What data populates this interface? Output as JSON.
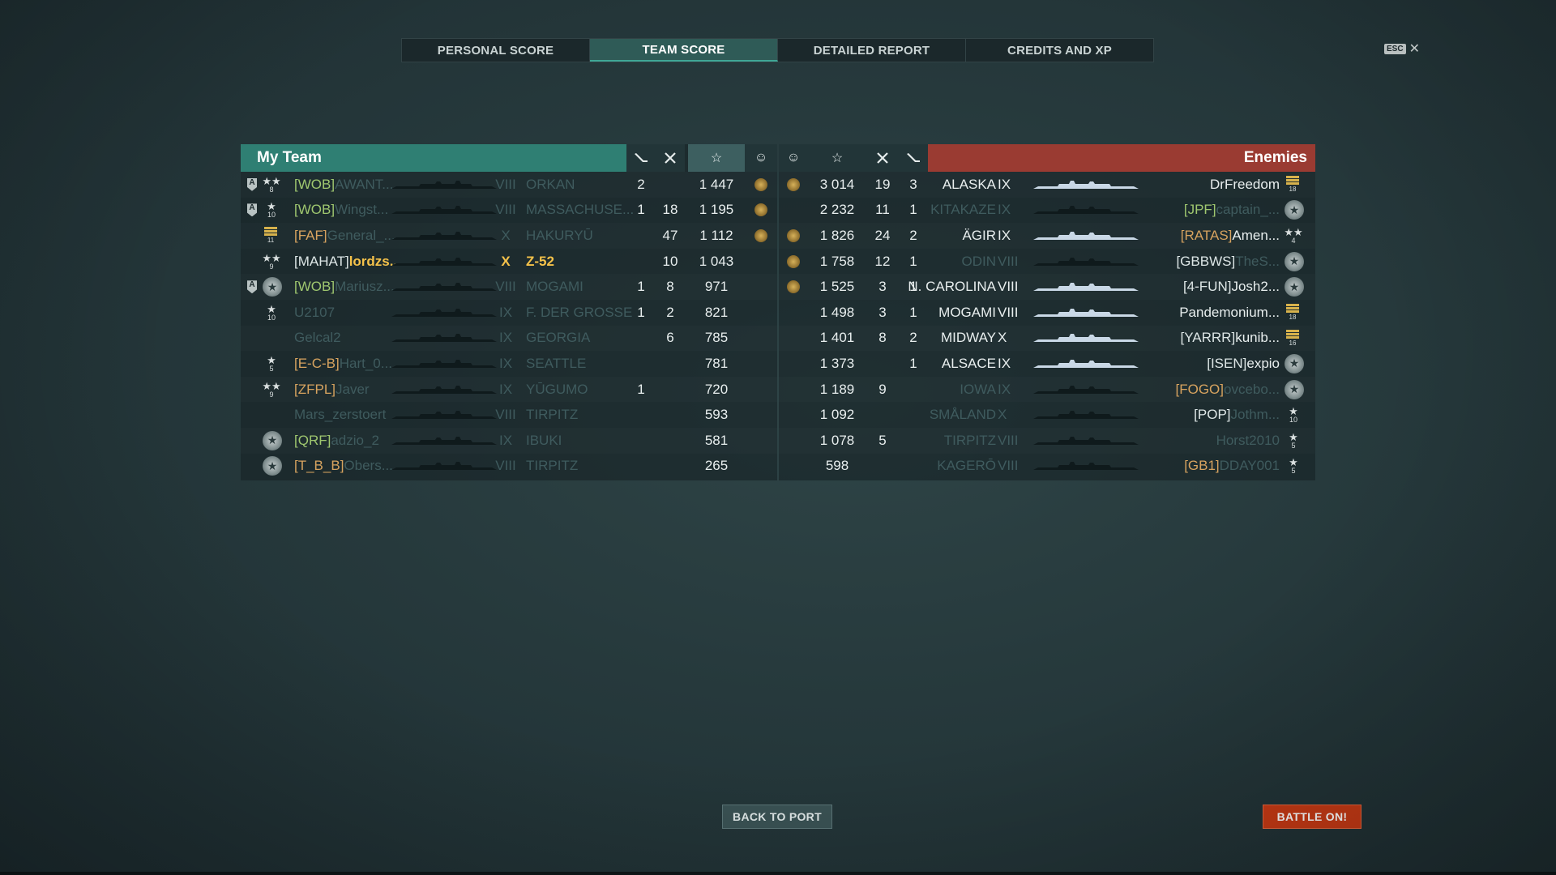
{
  "tabs": [
    "PERSONAL SCORE",
    "TEAM SCORE",
    "DETAILED REPORT",
    "CREDITS AND XP"
  ],
  "active_tab": 1,
  "esc_label": "ESC",
  "close_glyph": "✕",
  "my_team": {
    "title": "My Team",
    "rows": [
      {
        "badge": "A",
        "rank": "8",
        "rank_type": "stars2",
        "clan": "[WOB]",
        "clan_color": "green",
        "name": "AWANT...",
        "tier": "VIII",
        "ship": "ORKAN",
        "dimmed": true,
        "a": "2",
        "b": "",
        "score": "1 447",
        "medal": true
      },
      {
        "badge": "A",
        "rank": "10",
        "rank_type": "star",
        "clan": "[WOB]",
        "clan_color": "green",
        "name": "Wingst...",
        "tier": "VIII",
        "ship": "MASSACHUSE...",
        "dimmed": true,
        "a": "1",
        "b": "18",
        "score": "1 195",
        "medal": true
      },
      {
        "badge": "",
        "rank": "11",
        "rank_type": "stripes",
        "clan": "[FAF]",
        "clan_color": "orange",
        "name": "General_...",
        "tier": "X",
        "ship": "HAKURYŪ",
        "dimmed": true,
        "a": "",
        "b": "47",
        "score": "1 112",
        "medal": true
      },
      {
        "badge": "",
        "rank": "9",
        "rank_type": "stars2",
        "clan": "[MAHAT]",
        "clan_color": "white",
        "name": "lordzs...",
        "tier": "X",
        "ship": "Z-52",
        "dimmed": false,
        "me": true,
        "a": "",
        "b": "10",
        "score": "1 043",
        "medal": false
      },
      {
        "badge": "A",
        "rank": "",
        "rank_type": "emblem",
        "clan": "[WOB]",
        "clan_color": "green",
        "name": "Mariusz...",
        "tier": "VIII",
        "ship": "MOGAMI",
        "dimmed": true,
        "a": "1",
        "b": "8",
        "score": "971",
        "medal": false
      },
      {
        "badge": "",
        "rank": "10",
        "rank_type": "star",
        "clan": "",
        "clan_color": "green",
        "name": "U2107",
        "tier": "IX",
        "ship": "F. DER GROSSE",
        "dimmed": true,
        "a": "1",
        "b": "2",
        "score": "821",
        "medal": false
      },
      {
        "badge": "",
        "rank": "",
        "rank_type": "none",
        "clan": "",
        "clan_color": "green",
        "name": "Gelcal2",
        "tier": "IX",
        "ship": "GEORGIA",
        "dimmed": true,
        "a": "",
        "b": "6",
        "score": "785",
        "medal": false
      },
      {
        "badge": "",
        "rank": "5",
        "rank_type": "star",
        "clan": "[E-C-B]",
        "clan_color": "orange",
        "name": "Hart_0...",
        "tier": "IX",
        "ship": "SEATTLE",
        "dimmed": true,
        "a": "",
        "b": "",
        "score": "781",
        "medal": false
      },
      {
        "badge": "",
        "rank": "9",
        "rank_type": "stars2",
        "clan": "[ZFPL]",
        "clan_color": "orange",
        "name": "Javer",
        "tier": "IX",
        "ship": "YŪGUMO",
        "dimmed": true,
        "a": "1",
        "b": "",
        "score": "720",
        "medal": false
      },
      {
        "badge": "",
        "rank": "",
        "rank_type": "none",
        "clan": "",
        "clan_color": "green",
        "name": "Mars_zerstoert",
        "tier": "VIII",
        "ship": "TIRPITZ",
        "dimmed": true,
        "a": "",
        "b": "",
        "score": "593",
        "medal": false
      },
      {
        "badge": "",
        "rank": "",
        "rank_type": "emblem",
        "clan": "[QRF]",
        "clan_color": "green",
        "name": "adzio_2",
        "tier": "IX",
        "ship": "IBUKI",
        "dimmed": true,
        "a": "",
        "b": "",
        "score": "581",
        "medal": false
      },
      {
        "badge": "",
        "rank": "",
        "rank_type": "emblem",
        "clan": "[T_B_B]",
        "clan_color": "orange",
        "name": "Obers...",
        "tier": "VIII",
        "ship": "TIRPITZ",
        "dimmed": true,
        "a": "",
        "b": "",
        "score": "265",
        "medal": false
      }
    ]
  },
  "enemies": {
    "title": "Enemies",
    "rows": [
      {
        "medal": true,
        "score": "3 014",
        "b": "19",
        "a": "3",
        "ship": "ALASKA",
        "tier": "IX",
        "clan": "",
        "clan_color": "white",
        "name": "DrFreedom",
        "dimmed": false,
        "rank_type": "stripes",
        "rank": "18"
      },
      {
        "medal": false,
        "score": "2 232",
        "b": "11",
        "a": "1",
        "ship": "KITAKAZE",
        "tier": "IX",
        "clan": "[JPF]",
        "clan_color": "green",
        "name": "captain_...",
        "dimmed": true,
        "rank_type": "emblem",
        "rank": ""
      },
      {
        "medal": true,
        "score": "1 826",
        "b": "24",
        "a": "2",
        "ship": "ÄGIR",
        "tier": "IX",
        "clan": "[RATAS]",
        "clan_color": "orange",
        "name": "Amen...",
        "dimmed": false,
        "rank_type": "stars2",
        "rank": "4"
      },
      {
        "medal": true,
        "score": "1 758",
        "b": "12",
        "a": "1",
        "ship": "ODIN",
        "tier": "VIII",
        "clan": "[GBBWS]",
        "clan_color": "white",
        "name": "TheS...",
        "dimmed": true,
        "rank_type": "emblem",
        "rank": ""
      },
      {
        "medal": true,
        "score": "1 525",
        "b": "3",
        "a": "1",
        "ship": "N. CAROLINA",
        "tier": "VIII",
        "clan": "[4-FUN]",
        "clan_color": "white",
        "name": "Josh2...",
        "dimmed": false,
        "rank_type": "emblem",
        "rank": ""
      },
      {
        "medal": false,
        "score": "1 498",
        "b": "3",
        "a": "1",
        "ship": "MOGAMI",
        "tier": "VIII",
        "clan": "",
        "clan_color": "white",
        "name": "Pandemonium...",
        "dimmed": false,
        "rank_type": "stripes",
        "rank": "18"
      },
      {
        "medal": false,
        "score": "1 401",
        "b": "8",
        "a": "2",
        "ship": "MIDWAY",
        "tier": "X",
        "clan": "[YARRR]",
        "clan_color": "white",
        "name": "kunib...",
        "dimmed": false,
        "rank_type": "stripes",
        "rank": "16"
      },
      {
        "medal": false,
        "score": "1 373",
        "b": "",
        "a": "1",
        "ship": "ALSACE",
        "tier": "IX",
        "clan": "[ISEN]",
        "clan_color": "white",
        "name": "expio",
        "dimmed": false,
        "rank_type": "emblem",
        "rank": ""
      },
      {
        "medal": false,
        "score": "1 189",
        "b": "9",
        "a": "",
        "ship": "IOWA",
        "tier": "IX",
        "clan": "[FOGO]",
        "clan_color": "orange",
        "name": "ovcebo...",
        "dimmed": true,
        "rank_type": "emblem",
        "rank": ""
      },
      {
        "medal": false,
        "score": "1 092",
        "b": "",
        "a": "",
        "ship": "SMÅLAND",
        "tier": "X",
        "clan": "[POP]",
        "clan_color": "white",
        "name": "Jothm...",
        "dimmed": true,
        "rank_type": "star",
        "rank": "10"
      },
      {
        "medal": false,
        "score": "1 078",
        "b": "5",
        "a": "",
        "ship": "TIRPITZ",
        "tier": "VIII",
        "clan": "",
        "clan_color": "white",
        "name": "Horst2010",
        "dimmed": true,
        "rank_type": "star",
        "rank": "5"
      },
      {
        "medal": false,
        "score": "598",
        "b": "",
        "a": "",
        "ship": "KAGERŌ",
        "tier": "VIII",
        "clan": "[GB1]",
        "clan_color": "orange",
        "name": "DDAY001",
        "dimmed": true,
        "rank_type": "star",
        "rank": "5"
      }
    ]
  },
  "buttons": {
    "back": "BACK TO PORT",
    "battle": "BATTLE ON!"
  },
  "colors": {
    "my_team": "#2f7f73",
    "enemies": "#9a3b32",
    "battle_button": "#c73a15",
    "self_highlight": "#f5c24a"
  }
}
